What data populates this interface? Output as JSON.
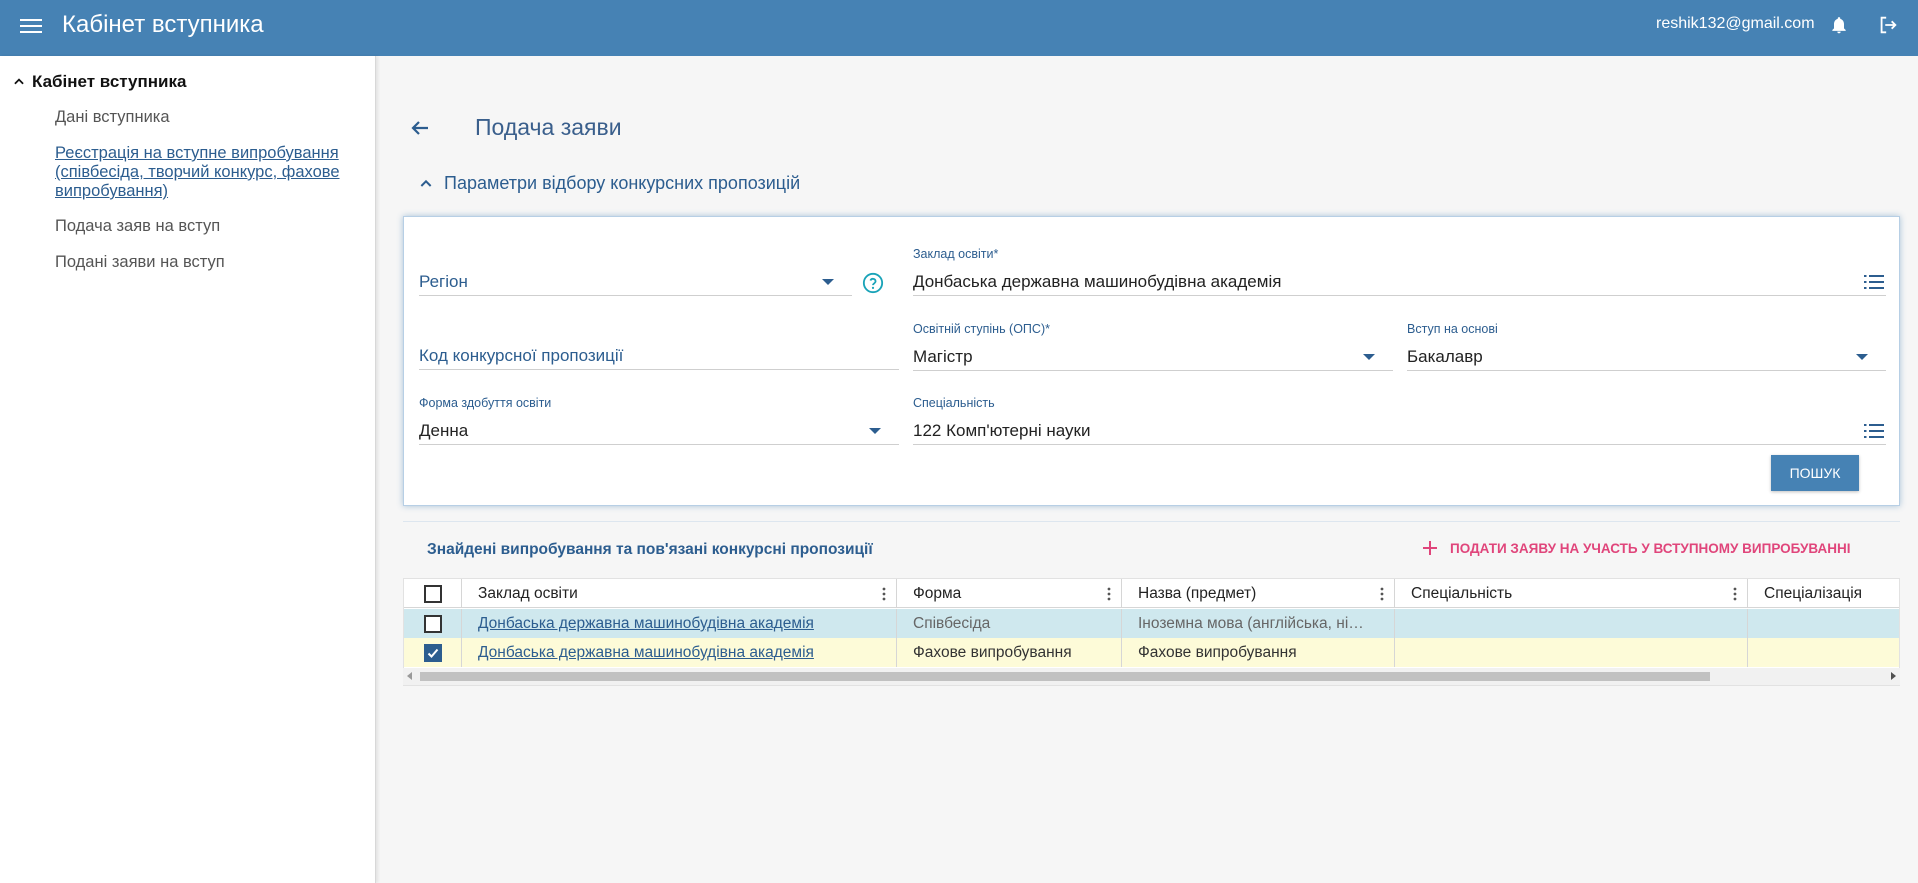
{
  "header": {
    "title": "Кабінет вступника",
    "user_email": "reshik132@gmail.com"
  },
  "sidebar": {
    "root": "Кабінет вступника",
    "items": [
      {
        "label": "Дані вступника",
        "active": false
      },
      {
        "label": "Реєстрація на вступне випробування (співбесіда, творчий конкурс, фахове випробування)",
        "active": true
      },
      {
        "label": "Подача заяв на вступ",
        "active": false
      },
      {
        "label": "Подані заяви на вступ",
        "active": false
      }
    ]
  },
  "page": {
    "title": "Подача заяви",
    "params_toggle": "Параметри відбору конкурсних пропозицій"
  },
  "filters": {
    "region": {
      "placeholder": "Регіон"
    },
    "institution": {
      "label": "Заклад освіти*",
      "value": "Донбаська державна машинобудівна академія"
    },
    "offer_code": {
      "placeholder": "Код конкурсної пропозиції"
    },
    "degree": {
      "label": "Освітній ступінь (ОПС)*",
      "value": "Магістр"
    },
    "basis": {
      "label": "Вступ на основі",
      "value": "Бакалавр"
    },
    "study_form": {
      "label": "Форма здобуття освіти",
      "value": "Денна"
    },
    "specialty": {
      "label": "Спеціальність",
      "value": "122 Комп'ютерні науки"
    },
    "search_label": "Пошук"
  },
  "results": {
    "title": "Знайдені випробування та пов'язані конкурсні пропозиції",
    "apply_label": "Подати заяву на участь у вступному випробуванні",
    "columns": [
      "Заклад освіти",
      "Форма",
      "Назва (предмет)",
      "Спеціальність",
      "Спеціалізація"
    ],
    "rows": [
      {
        "checked": false,
        "institution": "Донбаська державна машинобудівна академія",
        "form": "Співбесіда",
        "subject": "Іноземна мова (англійська, ні…",
        "specialty": "",
        "specialization": ""
      },
      {
        "checked": true,
        "institution": "Донбаська державна машинобудівна академія",
        "form": "Фахове випробування",
        "subject": "Фахове випробування",
        "specialty": "",
        "specialization": ""
      }
    ]
  },
  "colors": {
    "header_bg": "#4682b4",
    "accent": "#2c5d8f",
    "apply_pink": "#e0457b",
    "row_selected": "#cfe8ee",
    "row_checked": "#fdfbd8"
  }
}
